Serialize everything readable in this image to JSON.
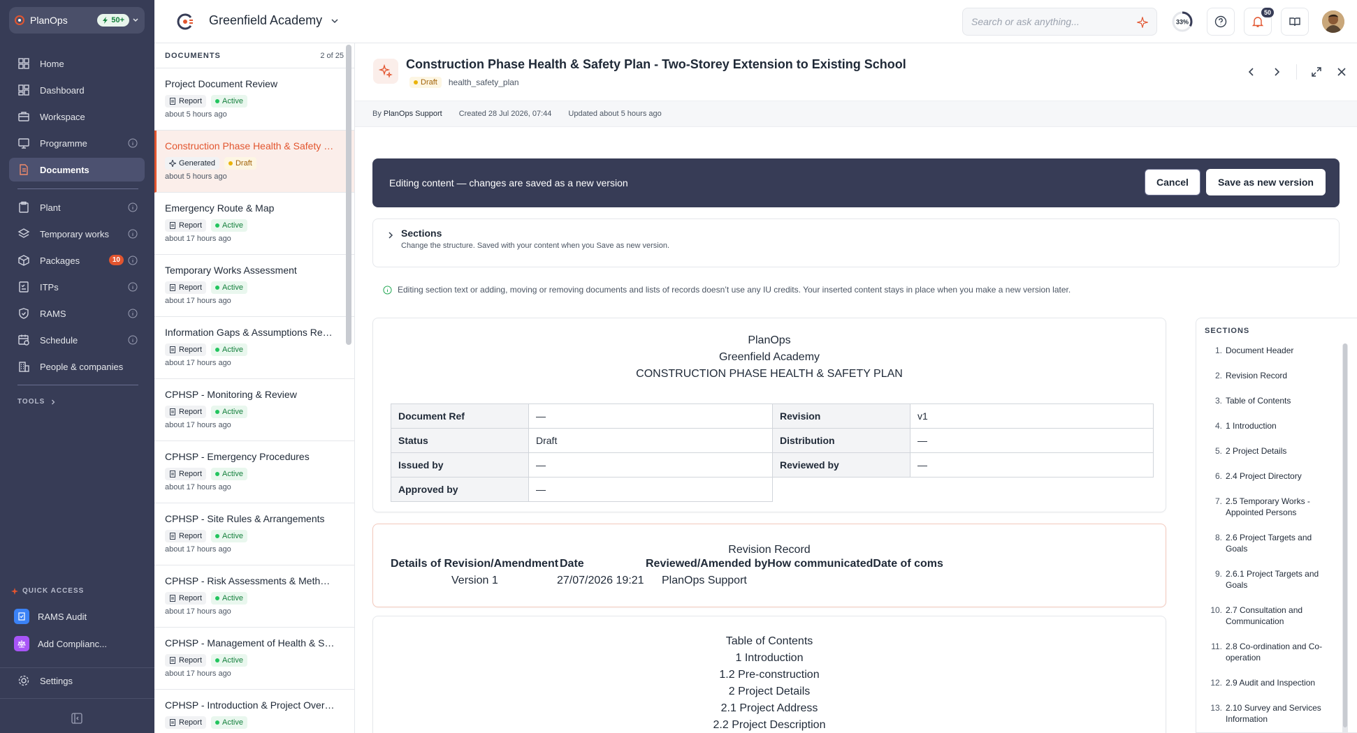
{
  "sidebar": {
    "org": "PlanOps",
    "credits": "50+",
    "nav": [
      "Home",
      "Dashboard",
      "Workspace",
      "Programme",
      "Documents",
      "Plant",
      "Temporary works",
      "Packages",
      "ITPs",
      "RAMS",
      "Schedule",
      "People & companies"
    ],
    "packages_count": "10",
    "tools_label": "TOOLS",
    "quick_access_label": "QUICK ACCESS",
    "quick": [
      "RAMS Audit",
      "Add Complianc..."
    ],
    "settings": "Settings"
  },
  "topbar": {
    "project": "Greenfield Academy",
    "search_placeholder": "Search or ask anything...",
    "progress": "33%",
    "notifications": "50"
  },
  "list": {
    "header": "DOCUMENTS",
    "count": "2 of 25",
    "items": [
      {
        "title": "Project Document Review",
        "type": "Report",
        "status": "Active",
        "time": "about 5 hours ago"
      },
      {
        "title": "Construction Phase Health & Safety Plan - Two-Storey Extension to Existing School",
        "type": "Generated",
        "status": "Draft",
        "time": "about 5 hours ago"
      },
      {
        "title": "Emergency Route & Map",
        "type": "Report",
        "status": "Active",
        "time": "about 17 hours ago"
      },
      {
        "title": "Temporary Works Assessment",
        "type": "Report",
        "status": "Active",
        "time": "about 17 hours ago"
      },
      {
        "title": "Information Gaps & Assumptions Register",
        "type": "Report",
        "status": "Active",
        "time": "about 17 hours ago"
      },
      {
        "title": "CPHSP - Monitoring & Review",
        "type": "Report",
        "status": "Active",
        "time": "about 17 hours ago"
      },
      {
        "title": "CPHSP - Emergency Procedures",
        "type": "Report",
        "status": "Active",
        "time": "about 17 hours ago"
      },
      {
        "title": "CPHSP - Site Rules & Arrangements",
        "type": "Report",
        "status": "Active",
        "time": "about 17 hours ago"
      },
      {
        "title": "CPHSP - Risk Assessments & Method Statements",
        "type": "Report",
        "status": "Active",
        "time": "about 17 hours ago"
      },
      {
        "title": "CPHSP - Management of Health & Safety",
        "type": "Report",
        "status": "Active",
        "time": "about 17 hours ago"
      },
      {
        "title": "CPHSP - Introduction & Project Overview",
        "type": "Report",
        "status": "Active",
        "time": ""
      }
    ]
  },
  "doc": {
    "title": "Construction Phase Health & Safety Plan - Two-Storey Extension to Existing School",
    "status": "Draft",
    "kind": "health_safety_plan",
    "by_label": "By",
    "by": "PlanOps Support",
    "created": "Created 28 Jul 2026, 07:44",
    "updated": "Updated about 5 hours ago",
    "editing_msg": "Editing content — changes are saved as a new version",
    "cancel": "Cancel",
    "save": "Save as new version",
    "sections_title": "Sections",
    "sections_sub": "Change the structure. Saved with your content when you Save as new version.",
    "info": "Editing section text or adding, moving or removing documents and lists of records doesn’t use any IU credits. Your inserted content stays in place when you make a new version later.",
    "header_lines": [
      "PlanOps",
      "Greenfield Academy",
      "CONSTRUCTION PHASE HEALTH & SAFETY PLAN"
    ],
    "meta_rows": [
      [
        "Document Ref",
        "—",
        "Revision",
        "v1"
      ],
      [
        "Status",
        "Draft",
        "Distribution",
        "—"
      ],
      [
        "Issued by",
        "—",
        "Reviewed by",
        "—"
      ],
      [
        "Approved by",
        "—",
        "",
        ""
      ]
    ],
    "revision_title": "Revision Record",
    "revision_headers": [
      "Details of Revision/Amendment",
      "Date",
      "Reviewed/Amended by",
      "How communicated",
      "Date of coms"
    ],
    "revision_row": [
      "Version 1",
      "27/07/2026 19:21",
      "PlanOps Support"
    ],
    "toc_title": "Table of Contents",
    "toc_lines": [
      "1 Introduction",
      "1.2 Pre-construction",
      "2 Project Details",
      "2.1 Project Address",
      "2.2 Project Description"
    ]
  },
  "toc_panel": {
    "title": "SECTIONS",
    "items": [
      {
        "n": "1.",
        "t": "Document Header"
      },
      {
        "n": "2.",
        "t": "Revision Record"
      },
      {
        "n": "3.",
        "t": "Table of Contents"
      },
      {
        "n": "4.",
        "t": "1 Introduction"
      },
      {
        "n": "5.",
        "t": "2 Project Details"
      },
      {
        "n": "6.",
        "t": "2.4 Project Directory"
      },
      {
        "n": "7.",
        "t": "2.5 Temporary Works - Appointed Persons"
      },
      {
        "n": "8.",
        "t": "2.6 Project Targets and Goals"
      },
      {
        "n": "9.",
        "t": "2.6.1 Project Targets and Goals"
      },
      {
        "n": "10.",
        "t": "2.7 Consultation and Communication"
      },
      {
        "n": "11.",
        "t": "2.8 Co-ordination and Co-operation"
      },
      {
        "n": "12.",
        "t": "2.9 Audit and Inspection"
      },
      {
        "n": "13.",
        "t": "2.10 Survey and Services Information"
      }
    ]
  }
}
